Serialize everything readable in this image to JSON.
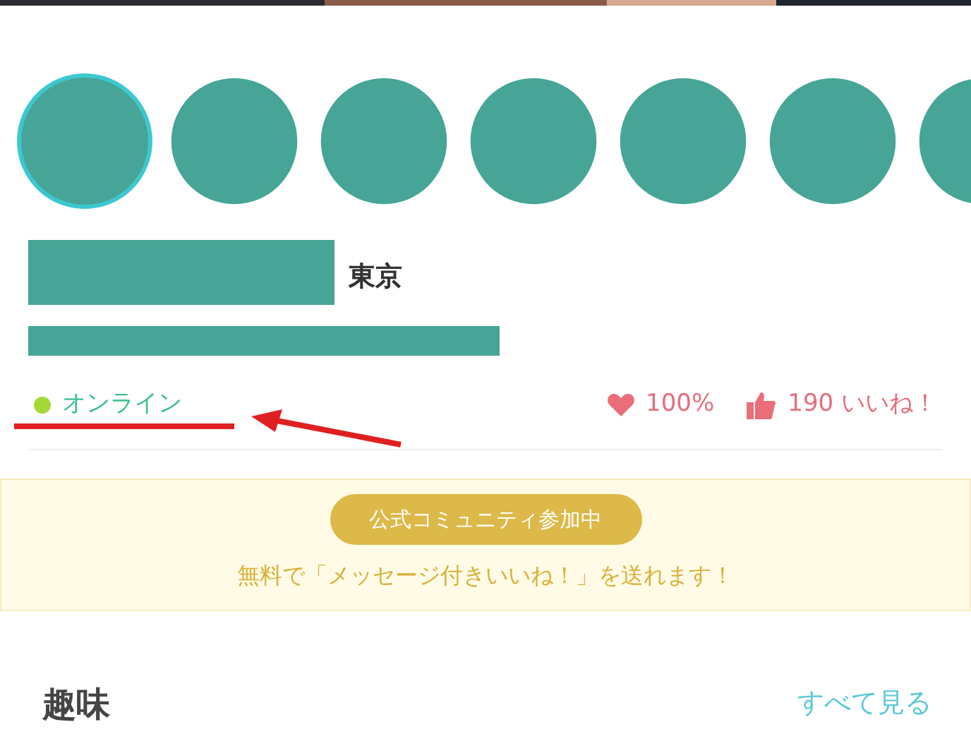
{
  "thumbnails": [
    {
      "selected": true
    },
    {
      "selected": false
    },
    {
      "selected": false
    },
    {
      "selected": false
    },
    {
      "selected": false
    },
    {
      "selected": false
    },
    {
      "selected": false
    }
  ],
  "profile": {
    "location": "東京"
  },
  "status": {
    "label": "オンライン",
    "online": true
  },
  "stats": [
    {
      "kind": "heart",
      "text": "100%"
    },
    {
      "kind": "thumb",
      "text": "190 いいね！"
    }
  ],
  "banner": {
    "badge": "公式コミュニティ参加中",
    "message": "無料で「メッセージ付きいいね！」を送れます！"
  },
  "section": {
    "title": "趣味",
    "link": "すべて見る"
  }
}
